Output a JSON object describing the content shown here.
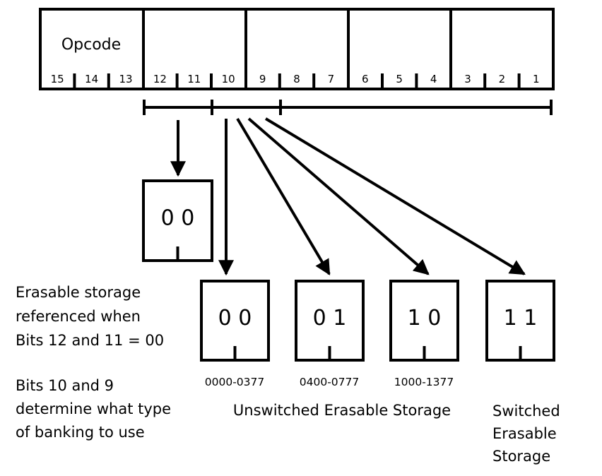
{
  "register": {
    "field_label": "Opcode",
    "bits": [
      "15",
      "14",
      "13",
      "12",
      "11",
      "10",
      "9",
      "8",
      "7",
      "6",
      "5",
      "4",
      "3",
      "2",
      "1"
    ]
  },
  "bank_box": {
    "value": "0 0"
  },
  "storage_boxes": [
    {
      "value": "0 0",
      "range": "0000-0377"
    },
    {
      "value": "0 1",
      "range": "0400-0777"
    },
    {
      "value": "1 0",
      "range": "1000-1377"
    },
    {
      "value": "1 1",
      "range": ""
    }
  ],
  "notes": {
    "erasable": [
      "Erasable storage",
      "referenced when",
      "Bits 12 and 11 = 00"
    ],
    "banking": [
      "Bits 10 and 9",
      "determine what type",
      "of banking to use"
    ]
  },
  "captions": {
    "unswitched": "Unswitched Erasable Storage",
    "switched": [
      "Switched",
      "Erasable",
      "Storage"
    ]
  }
}
